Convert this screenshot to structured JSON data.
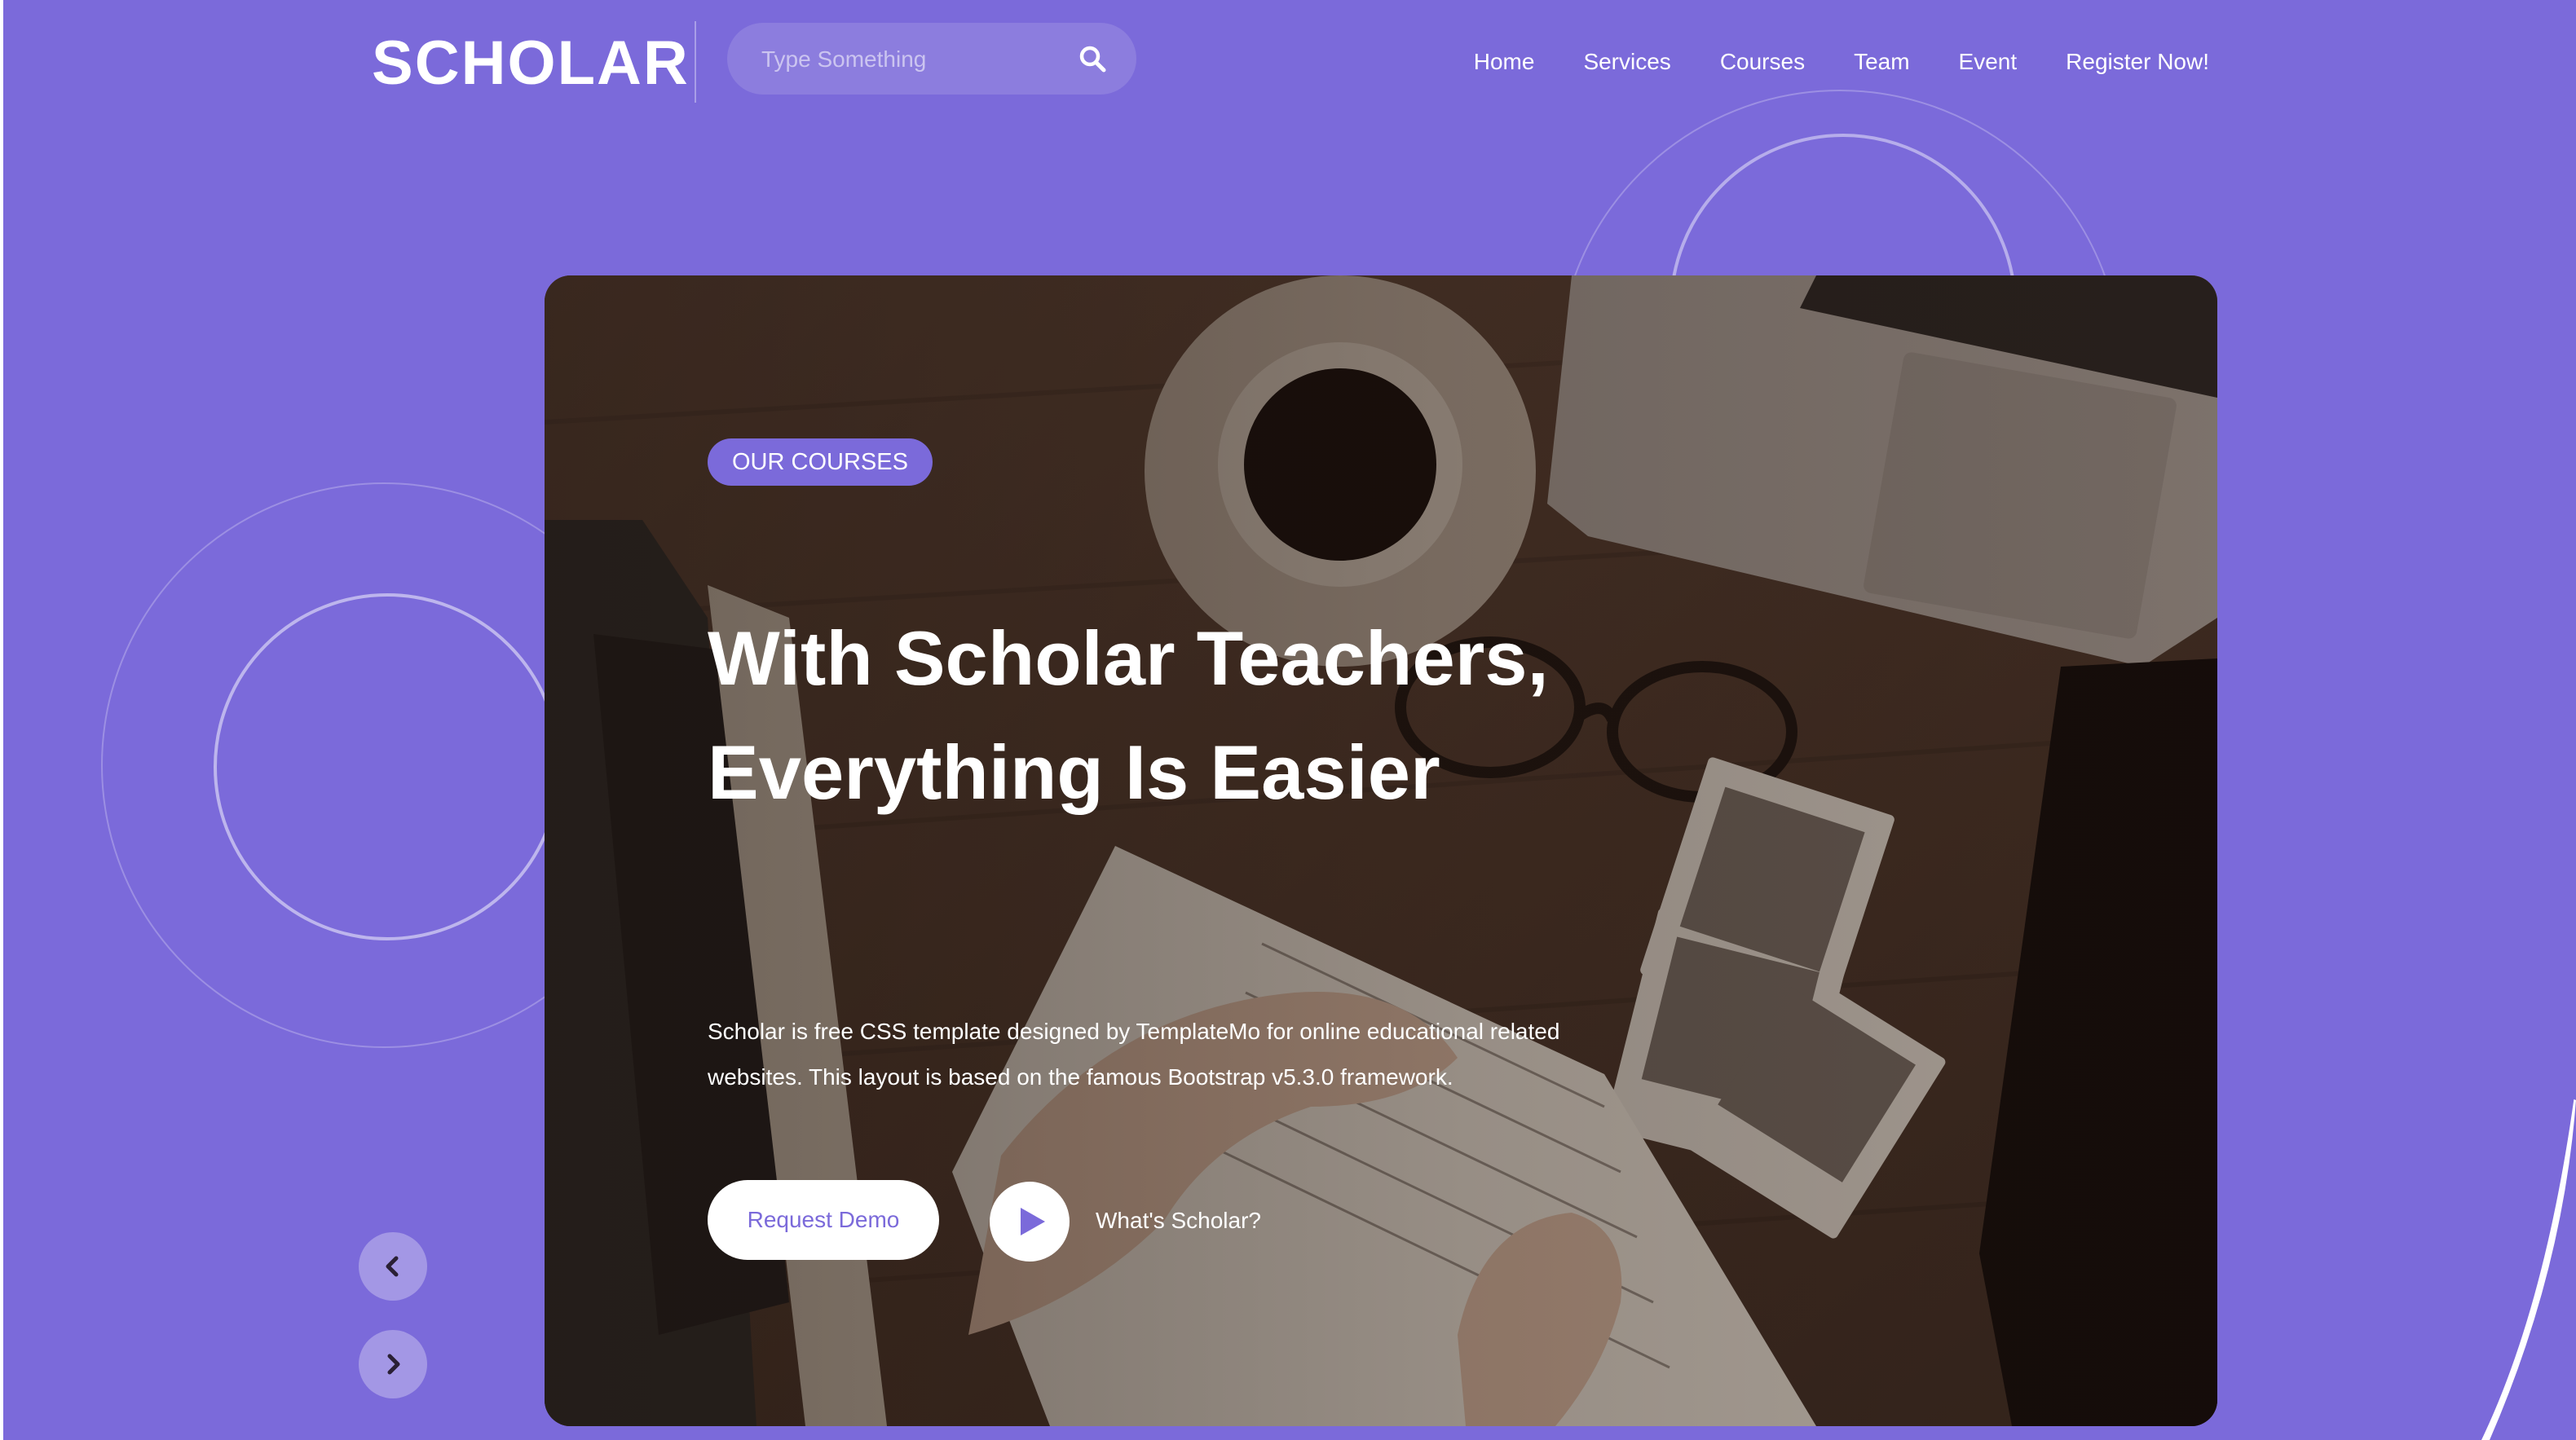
{
  "brand": {
    "name": "SCHOLAR"
  },
  "search": {
    "placeholder": "Type Something",
    "icon": "search-icon"
  },
  "nav": {
    "items": [
      "Home",
      "Services",
      "Courses",
      "Team",
      "Event",
      "Register Now!"
    ]
  },
  "hero": {
    "badge": "OUR COURSES",
    "headline": "With Scholar Teachers, Everything Is Easier",
    "description": "Scholar is free CSS template designed by TemplateMo for online educational related websites. This layout is based on the famous Bootstrap v5.3.0 framework.",
    "primary_button": "Request Demo",
    "video_label": "What's Scholar?"
  },
  "carousel": {
    "prev_icon": "chevron-left-icon",
    "next_icon": "chevron-right-icon"
  },
  "colors": {
    "primary": "#7b6ada",
    "white": "#ffffff"
  }
}
